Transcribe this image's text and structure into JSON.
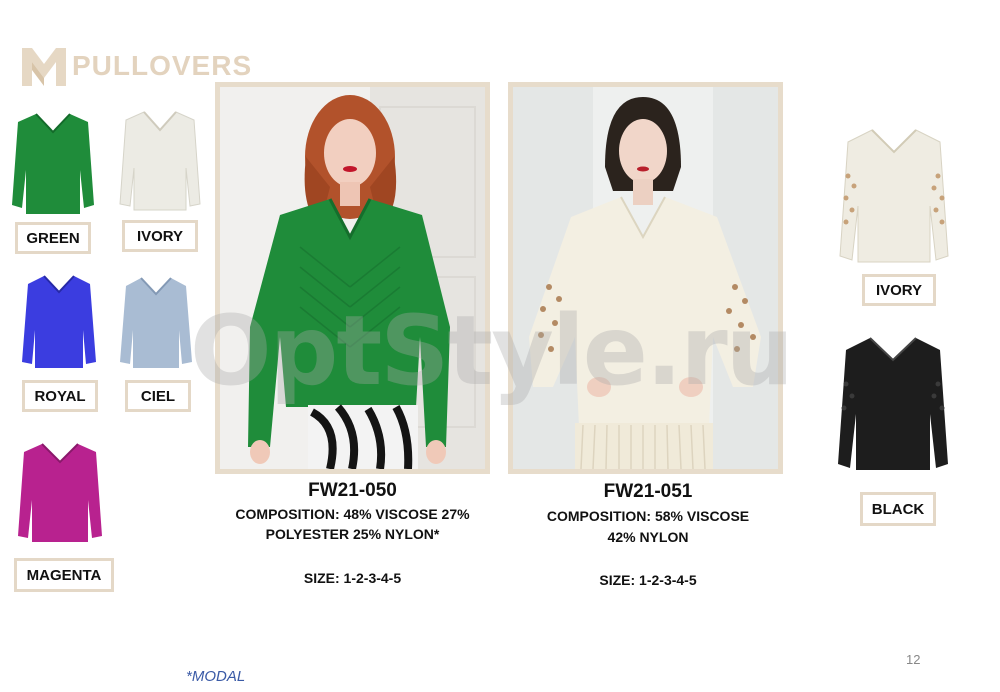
{
  "header": {
    "title": "PULLOVERS"
  },
  "swatches": [
    {
      "label": "GREEN",
      "color": "#1f8c3a"
    },
    {
      "label": "IVORY",
      "color": "#ecebe4"
    },
    {
      "label": "ROYAL",
      "color": "#3b3de0"
    },
    {
      "label": "CIEL",
      "color": "#a9bcd3"
    },
    {
      "label": "MAGENTA",
      "color": "#b8228f"
    }
  ],
  "right_swatches": [
    {
      "label": "IVORY",
      "color": "#efece2"
    },
    {
      "label": "BLACK",
      "color": "#1d1d1d"
    }
  ],
  "products": [
    {
      "code": "FW21-050",
      "composition_line1": "COMPOSITION: 48% VISCOSE 27%",
      "composition_line2": "POLYESTER 25% NYLON*",
      "size": "SIZE: 1-2-3-4-5"
    },
    {
      "code": "FW21-051",
      "composition_line1": "COMPOSITION: 58% VISCOSE",
      "composition_line2": "42% NYLON",
      "size": "SIZE: 1-2-3-4-5"
    }
  ],
  "watermark": "OptStyle.ru",
  "footnote": "*MODAL",
  "page_number": "12",
  "colors": {
    "frame": "#e7dccb",
    "logo": "#e3d3be"
  }
}
